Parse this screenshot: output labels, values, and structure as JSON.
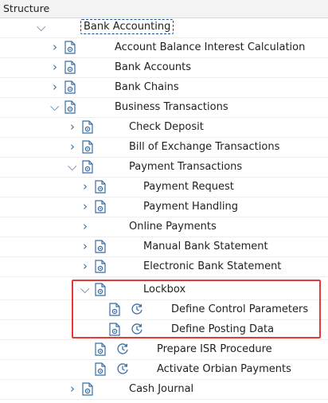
{
  "header": {
    "title": "Structure"
  },
  "tree": {
    "root": {
      "label": "Bank Accounting"
    },
    "account_balance": {
      "label": "Account Balance Interest Calculation"
    },
    "bank_accounts": {
      "label": "Bank Accounts"
    },
    "bank_chains": {
      "label": "Bank Chains"
    },
    "business_transactions": {
      "label": "Business Transactions"
    },
    "check_deposit": {
      "label": "Check Deposit"
    },
    "bill_of_exchange": {
      "label": "Bill of Exchange Transactions"
    },
    "payment_transactions": {
      "label": "Payment Transactions"
    },
    "payment_request": {
      "label": "Payment Request"
    },
    "payment_handling": {
      "label": "Payment Handling"
    },
    "online_payments": {
      "label": "Online Payments"
    },
    "manual_bank_statement": {
      "label": "Manual Bank Statement"
    },
    "electronic_bank_statement": {
      "label": "Electronic Bank Statement"
    },
    "lockbox": {
      "label": "Lockbox"
    },
    "define_control_parameters": {
      "label": "Define Control Parameters"
    },
    "define_posting_data": {
      "label": "Define Posting Data"
    },
    "prepare_isr": {
      "label": "Prepare ISR Procedure"
    },
    "activate_orbian": {
      "label": "Activate Orbian Payments"
    },
    "cash_journal": {
      "label": "Cash Journal"
    }
  },
  "colors": {
    "highlight_border": "#e23a3a",
    "chevron": "#3a6ea5",
    "doc_icon": "#3a6ea5"
  },
  "icons": {
    "expand": "chevron-right-icon",
    "collapse": "chevron-down-icon",
    "node": "document-gear-icon",
    "activity": "clock-icon"
  }
}
